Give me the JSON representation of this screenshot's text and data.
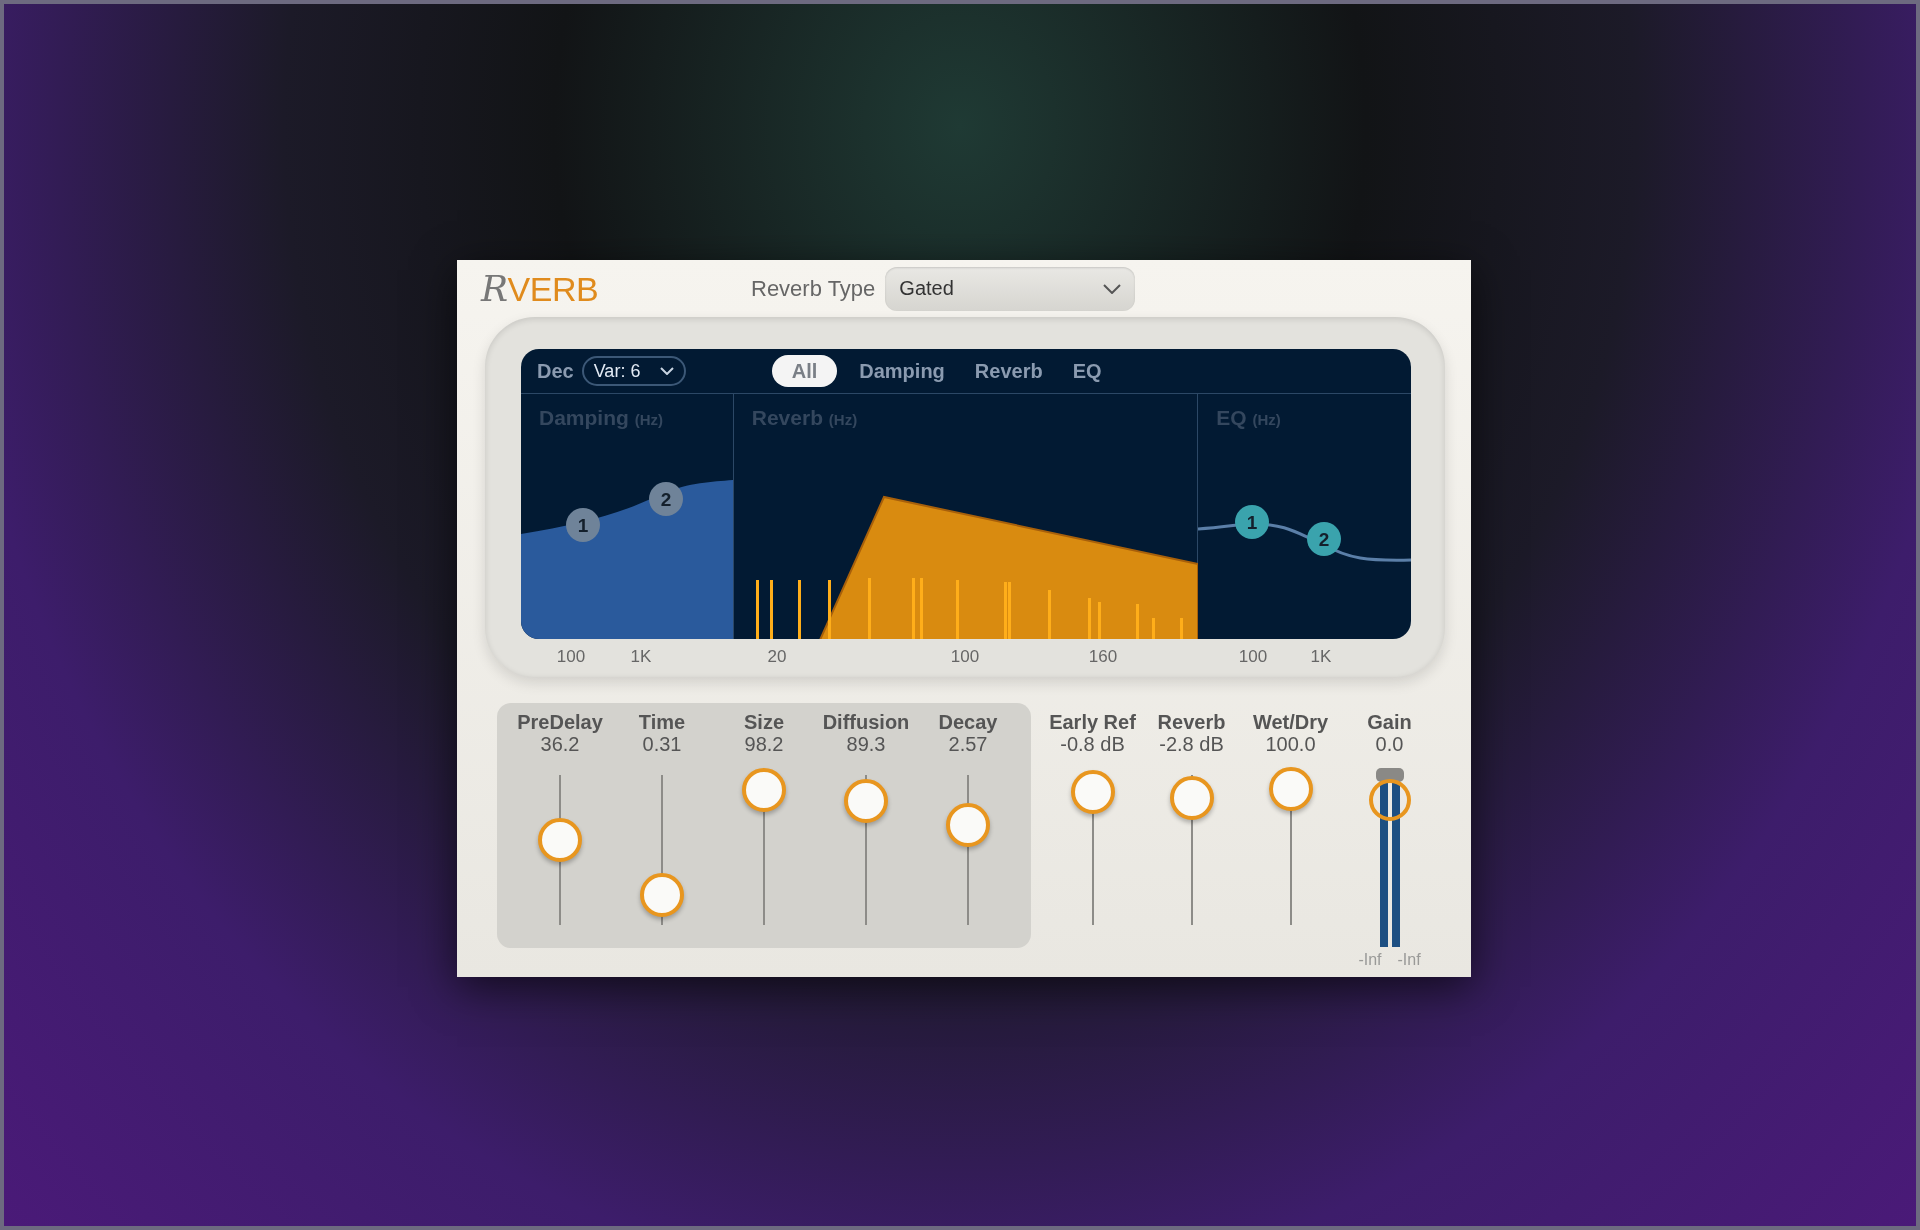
{
  "plugin": {
    "logo": "RVERB",
    "reverb_type": {
      "label": "Reverb Type",
      "value": "Gated"
    }
  },
  "graph": {
    "decay_label": "Dec",
    "variation": "Var: 6",
    "tabs": [
      {
        "label": "All",
        "selected": true
      },
      {
        "label": "Damping",
        "selected": false
      },
      {
        "label": "Reverb",
        "selected": false
      },
      {
        "label": "EQ",
        "selected": false
      }
    ],
    "panels": [
      {
        "kind": "damping",
        "title": "Damping",
        "unit": "(Hz)",
        "nodes": [
          "1",
          "2"
        ],
        "axis": [
          "100",
          "1K"
        ]
      },
      {
        "kind": "reverb",
        "title": "Reverb",
        "unit": "(Hz)",
        "axis": [
          "20",
          "100",
          "160"
        ]
      },
      {
        "kind": "eq",
        "title": "EQ",
        "unit": "(Hz)",
        "nodes": [
          "1",
          "2"
        ],
        "axis": [
          "100",
          "1K"
        ]
      }
    ]
  },
  "reverb_sliders": [
    {
      "label": "PreDelay",
      "reading": "36.2",
      "level": 0.57
    },
    {
      "label": "Time",
      "reading": "0.31",
      "level": 0.2
    },
    {
      "label": "Size",
      "reading": "98.2",
      "level": 0.9
    },
    {
      "label": "Diffusion",
      "reading": "89.3",
      "level": 0.83
    },
    {
      "label": "Decay",
      "reading": "2.57",
      "level": 0.67
    }
  ],
  "output_sliders": [
    {
      "label": "Early Ref",
      "reading": "-0.8 dB",
      "level": 0.89
    },
    {
      "label": "Reverb",
      "reading": "-2.8 dB",
      "level": 0.85
    },
    {
      "label": "Wet/Dry",
      "reading": "100.0",
      "level": 0.91
    }
  ],
  "gain": {
    "label": "Gain",
    "reading": "0.0",
    "level": 0.9,
    "meter_readings": [
      "-Inf",
      "-Inf"
    ]
  }
}
